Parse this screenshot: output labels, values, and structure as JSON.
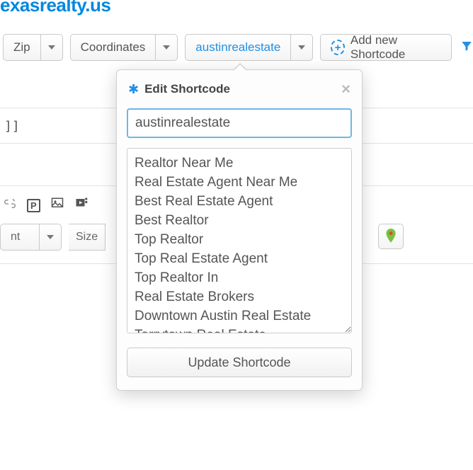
{
  "brand": "exasrealty.us",
  "toolbar": {
    "zip_label": "Zip",
    "coords_label": "Coordinates",
    "active_shortcode_label": "austinrealestate",
    "add_label": "Add new Shortcode"
  },
  "row_text": "]]",
  "format_bar": {
    "font_label": "nt",
    "size_label": "Size"
  },
  "modal": {
    "title": "Edit Shortcode",
    "input_value": "austinrealestate",
    "items": [
      "Realtor Near Me",
      "Real Estate Agent Near Me",
      "Best Real Estate Agent",
      "Best Realtor",
      "Top Realtor",
      "Top Real Estate Agent",
      "Top Realtor In",
      "Real Estate Brokers",
      "Downtown Austin Real Estate",
      "Tarrytown Real Estate"
    ],
    "update_label": "Update Shortcode"
  }
}
